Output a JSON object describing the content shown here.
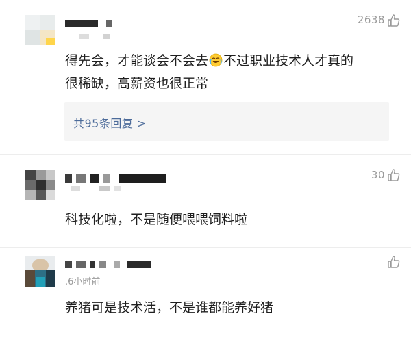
{
  "comments": [
    {
      "likes": "2638",
      "text_line1_a": "得先会，才能谈会不会去",
      "emoji": "crying-laughing-emoji",
      "text_line1_b": "不过职业技术人才真的",
      "text_line2": "很稀缺，高薪资也很正常",
      "replies_label": "共95条回复 >"
    },
    {
      "likes": "30",
      "text": "科技化啦，不是随便喂喂饲料啦"
    },
    {
      "likes": "",
      "time": ".6小时前",
      "text": "养猪可是技术活，不是谁都能养好猪"
    }
  ],
  "colors": {
    "text": "#1f1f1f",
    "muted": "#9a9a9a",
    "link": "#4c6b9a",
    "reply_bg": "#f5f5f5"
  }
}
